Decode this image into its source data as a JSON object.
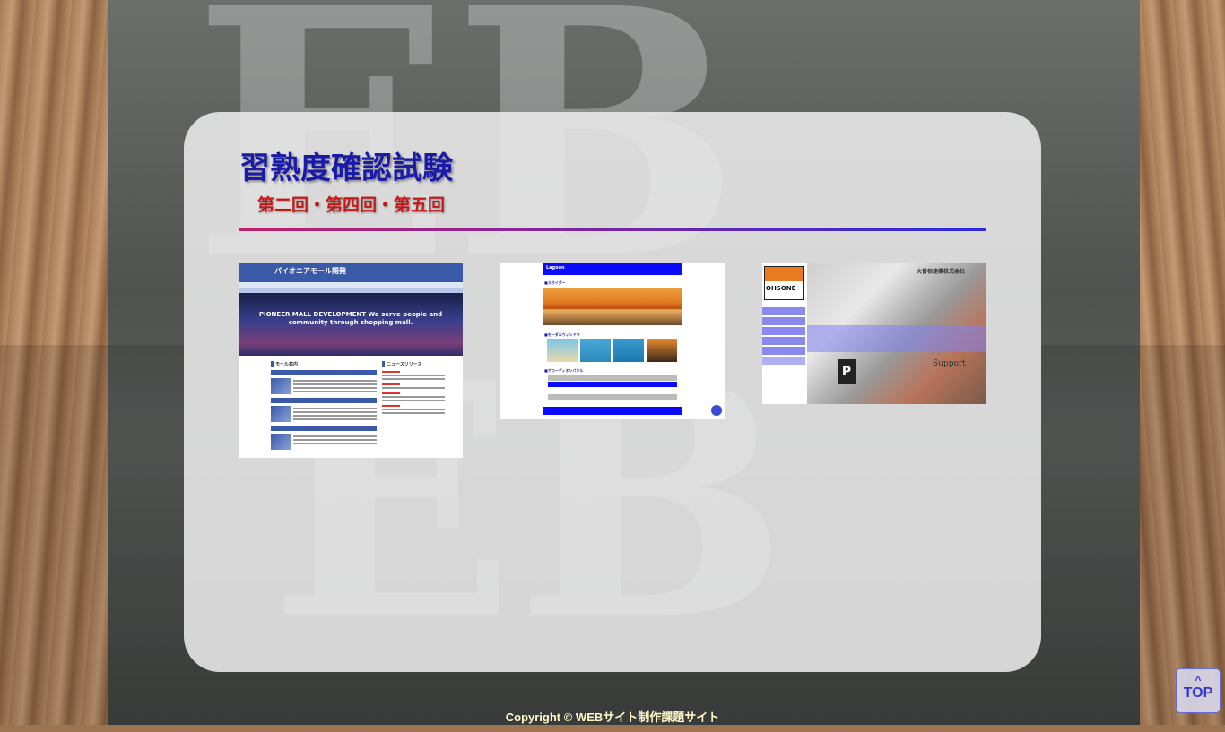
{
  "header": {
    "title": "習熟度確認試験",
    "subtitle": "第二回・第四回・第五回"
  },
  "thumbnails": [
    {
      "header_text": "パイオニアモール開発",
      "hero_text": "PIONEER MALL DEVELOPMENT We serve people and community through shopping mall.",
      "section_left": "モール案内",
      "section_right": "ニュースリリース"
    },
    {
      "header_text": "Lagoon",
      "label_slider": "■スライダー",
      "label_modal": "■モーダルウィンドウ",
      "label_accordion": "■アコーディオンパネル"
    },
    {
      "logo_text": "OHSONE",
      "company_text": "大曽根建業株式会社",
      "support_text": "Support",
      "sign_text": "P"
    }
  ],
  "footer": {
    "copyright": "Copyright © WEBサイト制作課題サイト"
  },
  "top_button": {
    "arrow": "^",
    "label": "TOP"
  },
  "colors": {
    "title": "#1a1aa8",
    "subtitle": "#c21818",
    "footer_text": "#fff9c8",
    "top_button_text": "#3838c8"
  }
}
